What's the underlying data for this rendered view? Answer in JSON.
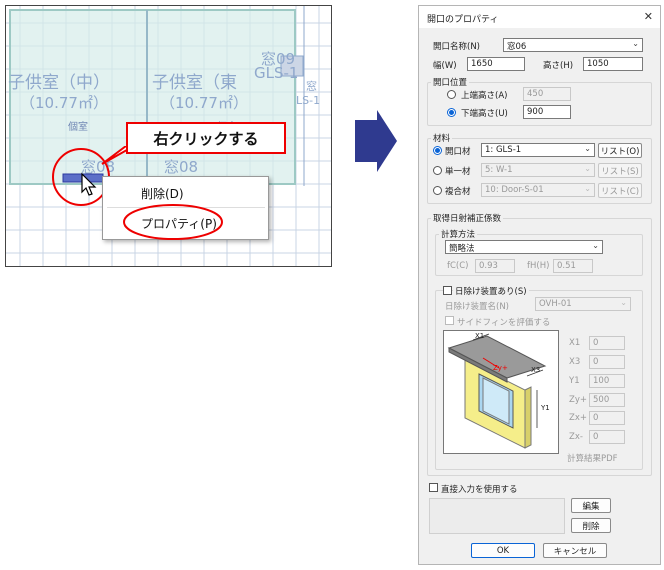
{
  "cad": {
    "room1_name": "子供室（中）",
    "room1_area": "（10.77㎡）",
    "room2_name": "子供室（東",
    "room2_area": "（10.77㎡）",
    "window_top_label": "窓09",
    "window_top_code": "GLS-1",
    "window_right_label": "窓",
    "window_right_code": "LS-1",
    "window_bottom1": "窓08",
    "window_bottom2": "窓08",
    "room_icon": "個室",
    "callout": "右クリックする",
    "menu": {
      "item1": "削除(D)",
      "item2": "プロパティ(P)"
    }
  },
  "dialog": {
    "title": "開口のプロパティ",
    "name_label": "開口名称(N)",
    "name_value": "窓06",
    "width_label": "幅(W)",
    "width_value": "1650",
    "height_label": "高さ(H)",
    "height_value": "1050",
    "position_group": "開口位置",
    "upper_label": "上端高さ(A)",
    "upper_value": "450",
    "lower_label": "下端高さ(U)",
    "lower_value": "900",
    "material_group": "材料",
    "mat1_label": "開口材",
    "mat1_value": "1: GLS-1",
    "mat2_label": "単一材",
    "mat2_value": "5: W-1",
    "mat3_label": "複合材",
    "mat3_value": "10: Door-S-01",
    "list1": "リスト(O)",
    "list2": "リスト(S)",
    "list3": "リスト(C)",
    "solar_group": "取得日射補正係数",
    "calc_group": "計算方法",
    "calc_value": "簡略法",
    "fc_label": "fC(C)",
    "fc_value": "0.93",
    "fh_label": "fH(H)",
    "fh_value": "0.51",
    "shade_check": "日除け装置あり(S)",
    "shade_name_label": "日除け装置名(N)",
    "shade_name_value": "OVH-01",
    "side_fin": "サイドフィンを評価する",
    "params": [
      {
        "label": "X1",
        "value": "0"
      },
      {
        "label": "X3",
        "value": "0"
      },
      {
        "label": "Y1",
        "value": "100"
      },
      {
        "label": "Zy+",
        "value": "500"
      },
      {
        "label": "Zx+",
        "value": "0"
      },
      {
        "label": "Zx-",
        "value": "0"
      }
    ],
    "diag_x1": "X1",
    "diag_x3": "X3",
    "diag_zy": "Zy+",
    "diag_y1": "Y1",
    "pdf_label": "計算結果PDF",
    "direct_check": "直接入力を使用する",
    "edit_btn": "編集",
    "delete_btn": "削除",
    "ok_btn": "OK",
    "cancel_btn": "キャンセル",
    "close": "✕"
  },
  "arrow_color": "#2f3a8f",
  "accent": "#e00000"
}
